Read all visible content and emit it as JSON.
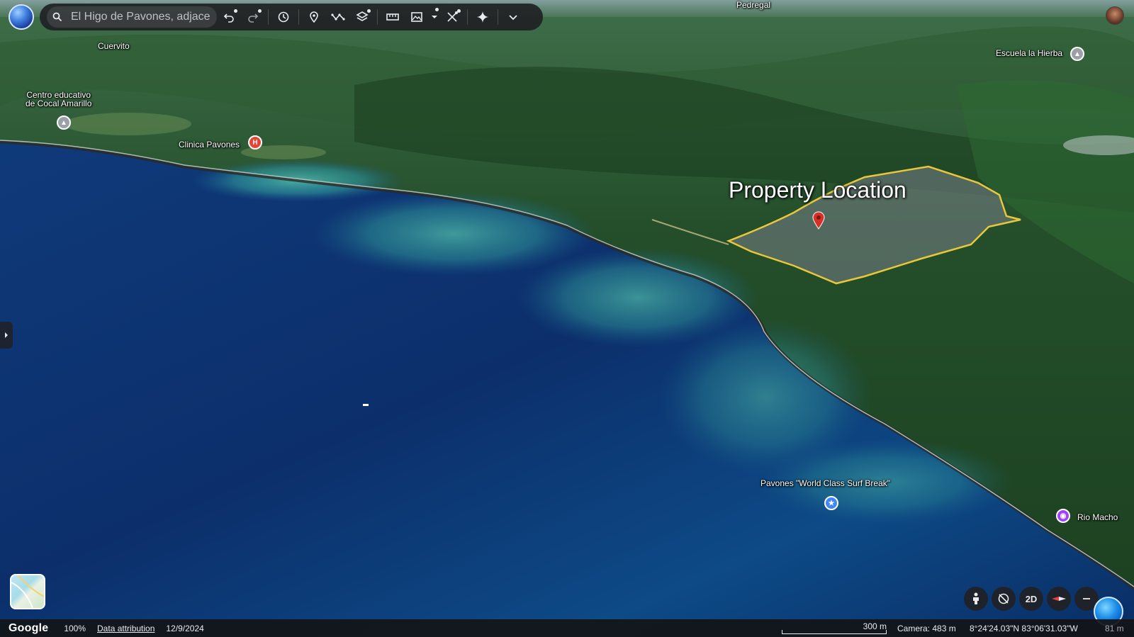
{
  "toolbar": {
    "search_value": "El Higo de Pavones, adjacent"
  },
  "icons": {
    "globe": "globe-icon",
    "search": "search-icon",
    "undo": "undo-icon",
    "redo": "redo-icon",
    "history": "history-icon",
    "placemark": "placemark-icon",
    "path": "path-icon",
    "layers": "layers-icon",
    "ruler": "ruler-icon",
    "image": "image-icon",
    "measure": "measure-icon",
    "sparkle": "sparkle-icon",
    "more": "chevron-down-icon"
  },
  "map": {
    "property_label": "Property Location",
    "places": {
      "cuervito": "Cuervito",
      "centro_line1": "Centro educativo",
      "centro_line2": "de Cocal Amarillo",
      "clinica": "Clinica Pavones",
      "escuela": "Escuela la Hierba",
      "surf_break": "Pavones \"World Class Surf Break\"",
      "rio_macho": "Rio Macho",
      "pedregal": "Pedregal"
    },
    "polygon_color": "#e8c83a",
    "pin_color": "#d93025"
  },
  "controls": {
    "two_d": "2D"
  },
  "status": {
    "brand": "Google",
    "zoom": "100%",
    "attribution": "Data attribution",
    "date": "12/9/2024",
    "scale": "300 m",
    "camera": "Camera: 483 m",
    "coords": "8°24'24.03\"N 83°06'31.03\"W",
    "altitude": "81 m"
  }
}
